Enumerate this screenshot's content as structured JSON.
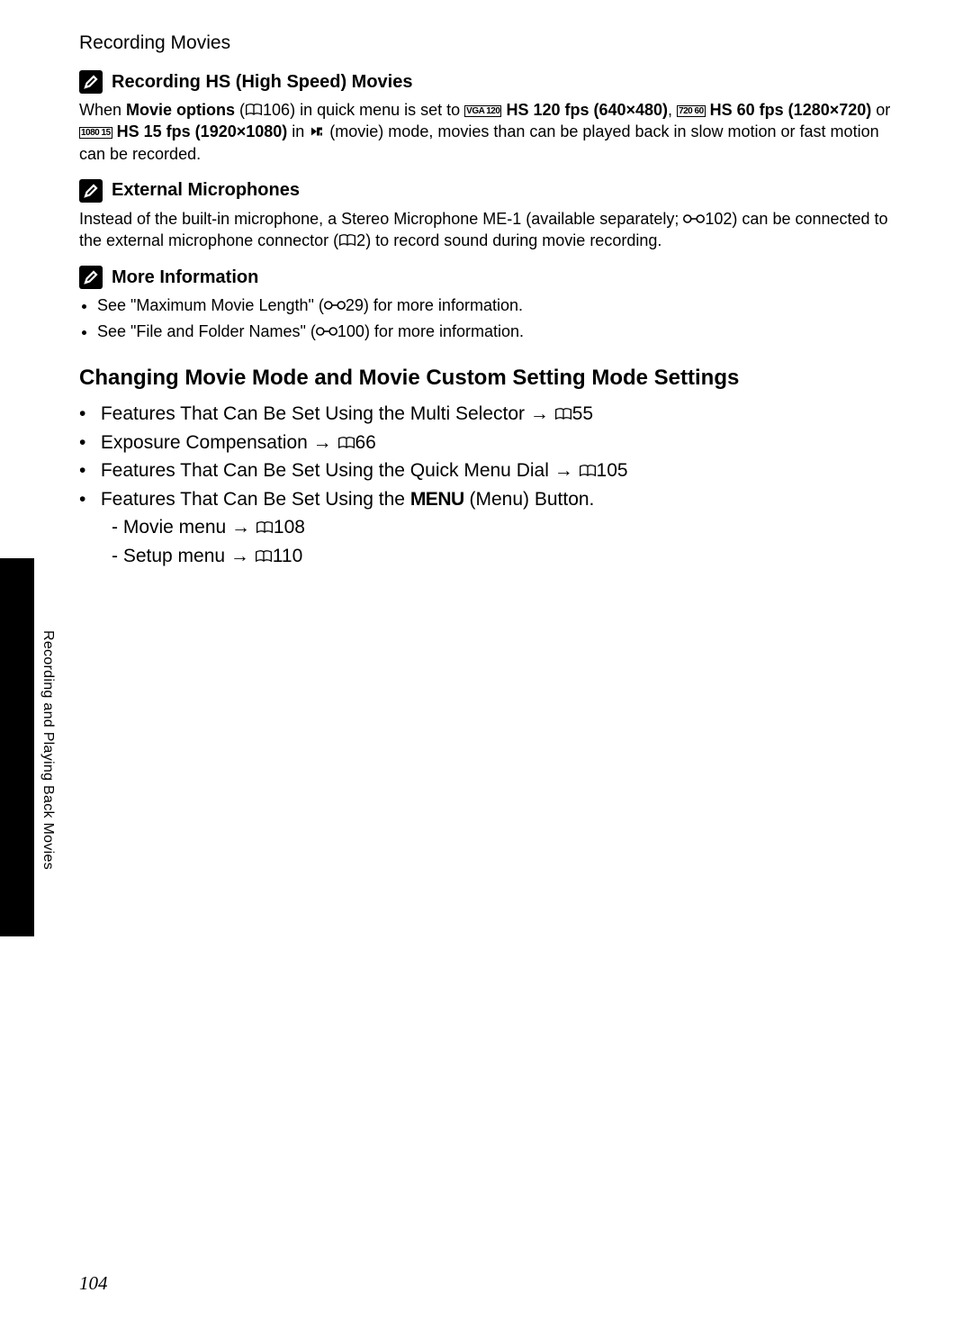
{
  "header": {
    "title": "Recording Movies"
  },
  "notes": [
    {
      "title": "Recording HS (High Speed) Movies",
      "body": {
        "pre": "When ",
        "b1": "Movie options",
        "p1": " (",
        "ref1": "106",
        "p2": ") in quick menu  is set to ",
        "mode1": "VGA 120",
        "b2": " HS 120 fps (640×480)",
        "p3": ", ",
        "mode2": "720 60",
        "b3": " HS 60 fps (1280×720)",
        "p4": " or ",
        "mode3": "1080 15",
        "b4": " HS 15 fps (1920×1080)",
        "p5": " in ",
        "p6": " (movie) mode, movies than can be played back in slow motion or fast motion can be recorded."
      }
    },
    {
      "title": "External Microphones",
      "body": {
        "pre": "Instead of the built-in microphone, a Stereo Microphone ME-1 (available separately; ",
        "ref1": "102",
        "p1": ") can be connected to the external microphone connector (",
        "ref2": "2",
        "p2": ") to record sound during movie recording."
      }
    },
    {
      "title": "More Information",
      "items": [
        {
          "pre": "See \"Maximum Movie Length\" (",
          "ref": "29",
          "post": ") for more information."
        },
        {
          "pre": "See \"File and Folder Names\" (",
          "ref": "100",
          "post": ") for more information."
        }
      ]
    }
  ],
  "section": {
    "title": "Changing Movie Mode and Movie Custom Setting Mode Settings",
    "items": [
      {
        "text": "Features That Can Be Set Using the Multi Selector ",
        "arrow": "→",
        "ref": "55"
      },
      {
        "text": "Exposure Compensation ",
        "arrow": "→",
        "ref": "66"
      },
      {
        "text": "Features That Can Be Set Using the Quick Menu Dial ",
        "arrow": "→",
        "ref": "105"
      },
      {
        "text": "Features That Can Be Set Using the ",
        "menu": "MENU",
        "text2": " (Menu) Button.",
        "sub": [
          {
            "text": "Movie menu ",
            "arrow": "→",
            "ref": "108"
          },
          {
            "text": "Setup menu ",
            "arrow": "→",
            "ref": "110"
          }
        ]
      }
    ]
  },
  "sideLabel": "Recording and Playing Back Movies",
  "pageNumber": "104"
}
